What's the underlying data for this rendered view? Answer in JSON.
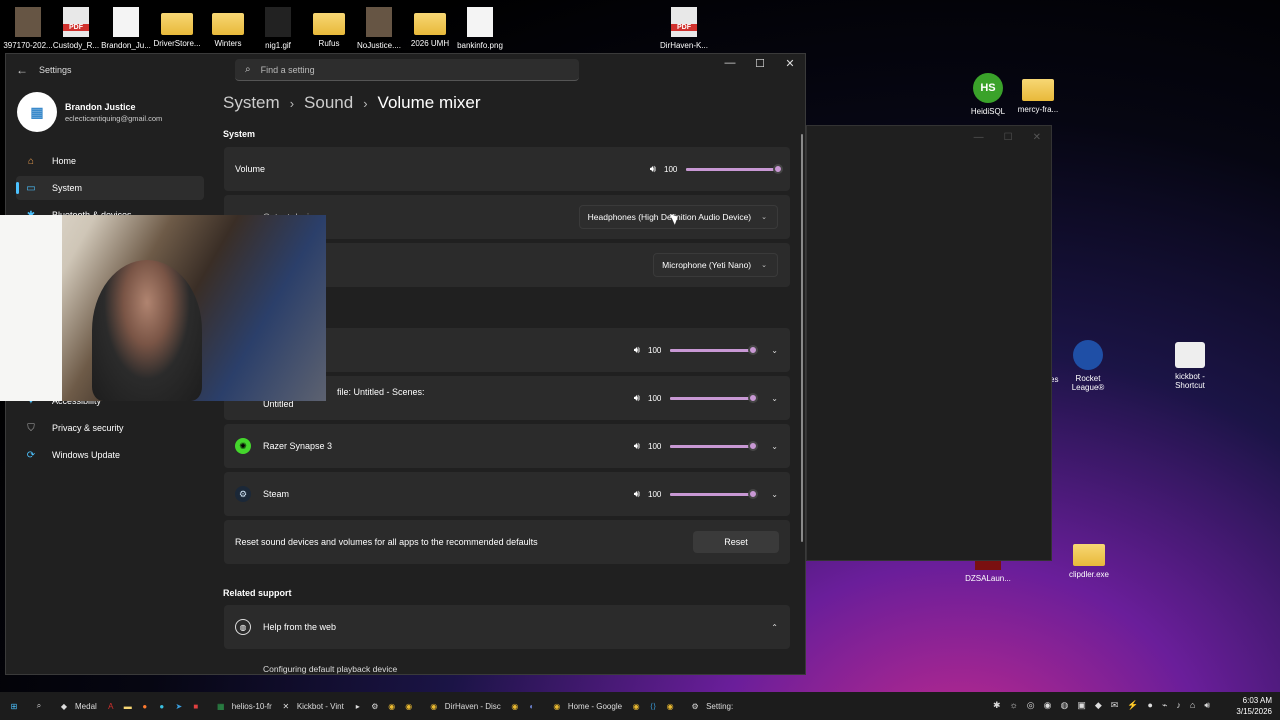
{
  "desktop": {
    "icons": [
      {
        "label": "397170-202...",
        "type": "img"
      },
      {
        "label": "Custody_R...",
        "type": "pdf"
      },
      {
        "label": "Brandon_Ju...",
        "type": "doc"
      },
      {
        "label": "DriverStore...",
        "type": "folder"
      },
      {
        "label": "Winters",
        "type": "folder"
      },
      {
        "label": "nig1.gif",
        "type": "gif"
      },
      {
        "label": "Rufus",
        "type": "folder"
      },
      {
        "label": "NoJustice....",
        "type": "img"
      },
      {
        "label": "2026 UMH",
        "type": "folder"
      },
      {
        "label": "bankinfo.png",
        "type": "doc"
      },
      {
        "label": "DirHaven-K...",
        "type": "pdf"
      },
      {
        "label": "HeidiSQL",
        "type": "hs"
      },
      {
        "label": "mercy-fra...",
        "type": "folder"
      },
      {
        "label": "Rocket League®",
        "type": "rl"
      },
      {
        "label": "kickbot - Shortcut",
        "type": "gear"
      },
      {
        "label": "DZSALaun...",
        "type": "img"
      },
      {
        "label": "clipdler.exe",
        "type": "folder"
      }
    ],
    "partial_label": "es"
  },
  "settings": {
    "app_title": "Settings",
    "search_placeholder": "Find a setting",
    "profile": {
      "name": "Brandon Justice",
      "email": "eclecticantiquing@gmail.com"
    },
    "nav": [
      {
        "label": "Home",
        "icon": "home-icon"
      },
      {
        "label": "System",
        "icon": "system-icon",
        "active": true
      },
      {
        "label": "Bluetooth & devices",
        "icon": "bluetooth-icon"
      },
      {
        "label": "Accessibility",
        "icon": "accessibility-icon"
      },
      {
        "label": "Privacy & security",
        "icon": "shield-icon"
      },
      {
        "label": "Windows Update",
        "icon": "update-icon"
      }
    ],
    "breadcrumb": [
      "System",
      "Sound",
      "Volume mixer"
    ],
    "system_section": "System",
    "volume": {
      "label": "Volume",
      "value": "100",
      "level": 1.0
    },
    "output": {
      "label": "Output device",
      "value": "Headphones (High Definition Audio Device)"
    },
    "input": {
      "value": "Microphone (Yeti Nano)"
    },
    "apps": [
      {
        "name": "",
        "value": "100",
        "level": 1.0
      },
      {
        "name": "file: Untitled - Scenes:",
        "name2": "Untitled",
        "value": "100",
        "level": 1.0
      },
      {
        "name": "Razer Synapse 3",
        "value": "100",
        "level": 1.0
      },
      {
        "name": "Steam",
        "value": "100",
        "level": 1.0
      }
    ],
    "reset": {
      "label": "Reset sound devices and volumes for all apps to the recommended defaults",
      "button": "Reset"
    },
    "related": {
      "heading": "Related support",
      "help": "Help from the web",
      "link": "Configuring default playback device"
    }
  },
  "taskbar": {
    "items": [
      "Medal",
      "helios-10-fr",
      "Kickbot - Vint",
      "DirHaven - Disc",
      "Home - Google",
      "Setting:"
    ],
    "time": "6:03 AM",
    "date": "3/15/2026"
  },
  "colors": {
    "accent": "#4cc2ff",
    "slider": "#c898d4",
    "card": "#2b2b2b",
    "window": "#202020"
  }
}
